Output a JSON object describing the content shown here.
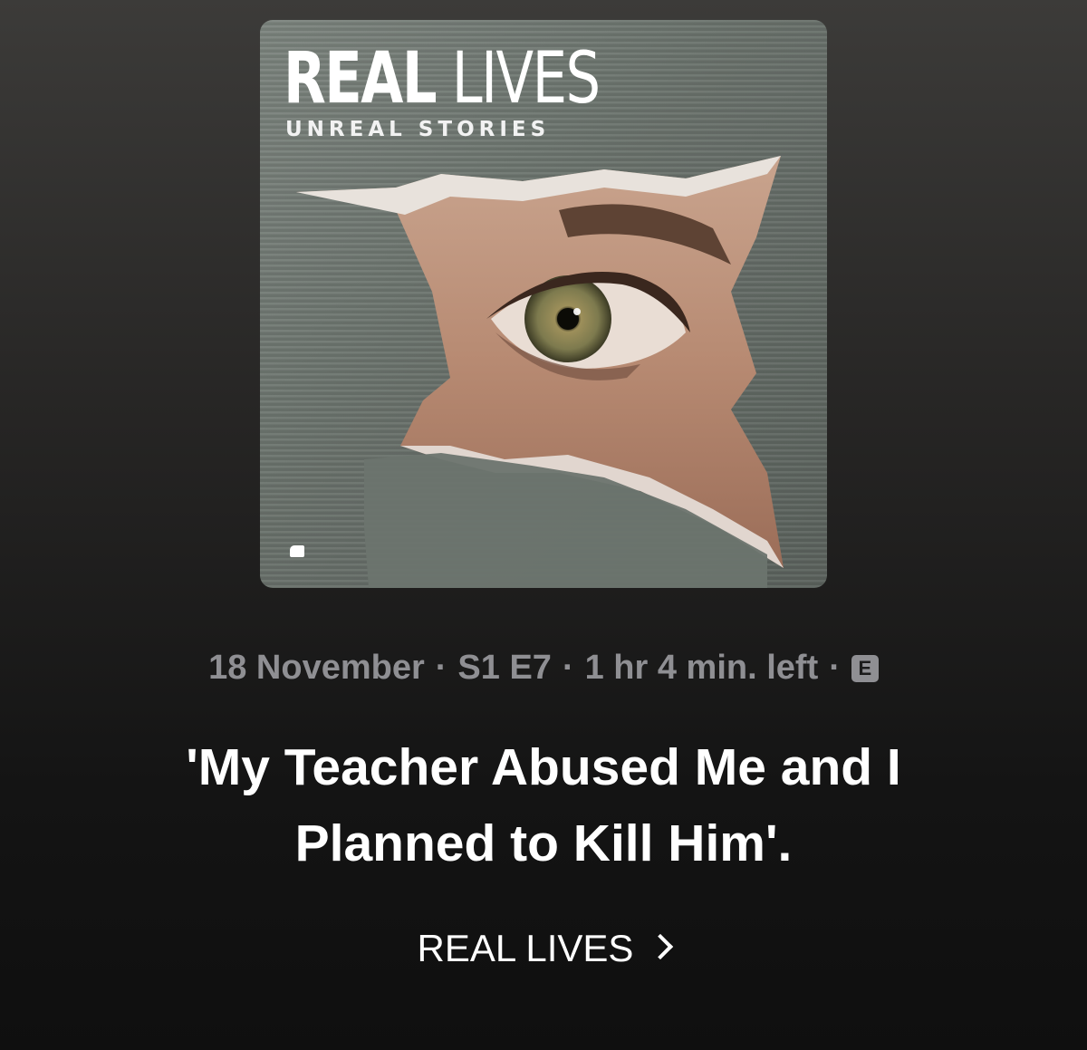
{
  "artwork": {
    "title_bold": "REAL",
    "title_light": "LIVES",
    "subtitle": "UNREAL STORIES"
  },
  "meta": {
    "date": "18 November",
    "separator": "·",
    "episode": "S1 E7",
    "time_left": "1 hr 4 min. left",
    "explicit_badge": "E"
  },
  "episode_title": "'My Teacher Abused Me and I Planned to Kill Him'.",
  "show": {
    "name": "REAL LIVES",
    "chevron_icon": "chevron-right-icon"
  },
  "colors": {
    "background_top": "#3c3b39",
    "background_bottom": "#0f0f0f",
    "meta_text": "#8f8f93",
    "title_text": "#ffffff"
  }
}
